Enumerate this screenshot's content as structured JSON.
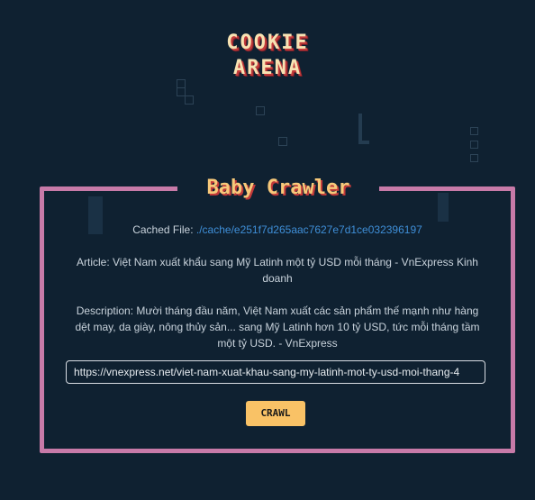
{
  "logo": {
    "line1": "COOKIE",
    "line2": "ARENA"
  },
  "card": {
    "title": "Baby Crawler",
    "cached_label": "Cached File: ",
    "cached_link": "./cache/e251f7d265aac7627e7d1ce032396197",
    "article_text": "Article: Việt Nam xuất khẩu sang Mỹ Latinh một tỷ USD mỗi tháng - VnExpress Kinh doanh",
    "description_text": "Description: Mười tháng đầu năm, Việt Nam xuất các sản phẩm thế mạnh như hàng dệt may, da giày, nông thủy sản... sang Mỹ Latinh hơn 10 tỷ USD, tức mỗi tháng tầm một tỷ USD. - VnExpress",
    "url_value": "https://vnexpress.net/viet-nam-xuat-khau-sang-my-latinh-mot-ty-usd-moi-thang-4",
    "crawl_label": "CRAWL"
  },
  "colors": {
    "background": "#0f2131",
    "card_border": "#c77aa8",
    "title": "#f7c97a",
    "link": "#3f8fd8",
    "button": "#f9c266"
  }
}
